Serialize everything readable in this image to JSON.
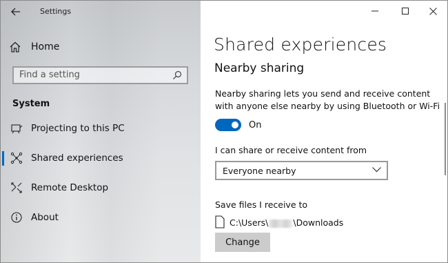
{
  "window": {
    "app_title": "Settings",
    "controls": {
      "minimize": "minimize",
      "maximize": "maximize",
      "close": "close"
    }
  },
  "sidebar": {
    "home_label": "Home",
    "search": {
      "placeholder": "Find a setting"
    },
    "section_title": "System",
    "items": [
      {
        "label": "Projecting to this PC",
        "icon": "projector-icon",
        "selected": false
      },
      {
        "label": "Shared experiences",
        "icon": "shared-experiences-icon",
        "selected": true
      },
      {
        "label": "Remote Desktop",
        "icon": "remote-desktop-icon",
        "selected": false
      },
      {
        "label": "About",
        "icon": "info-icon",
        "selected": false
      }
    ]
  },
  "main": {
    "page_title": "Shared experiences",
    "section_title": "Nearby sharing",
    "description": "Nearby sharing lets you send and receive content with anyone else nearby by using Bluetooth or Wi-Fi",
    "toggle": {
      "state": "On",
      "on": true
    },
    "share_label": "I can share or receive content from",
    "share_dropdown_value": "Everyone nearby",
    "save_label": "Save files I receive to",
    "path_prefix": "C:\\Users\\",
    "path_suffix": "\\Downloads",
    "change_button": "Change"
  },
  "colors": {
    "accent": "#0067c0",
    "button_bg": "#cccccc"
  }
}
